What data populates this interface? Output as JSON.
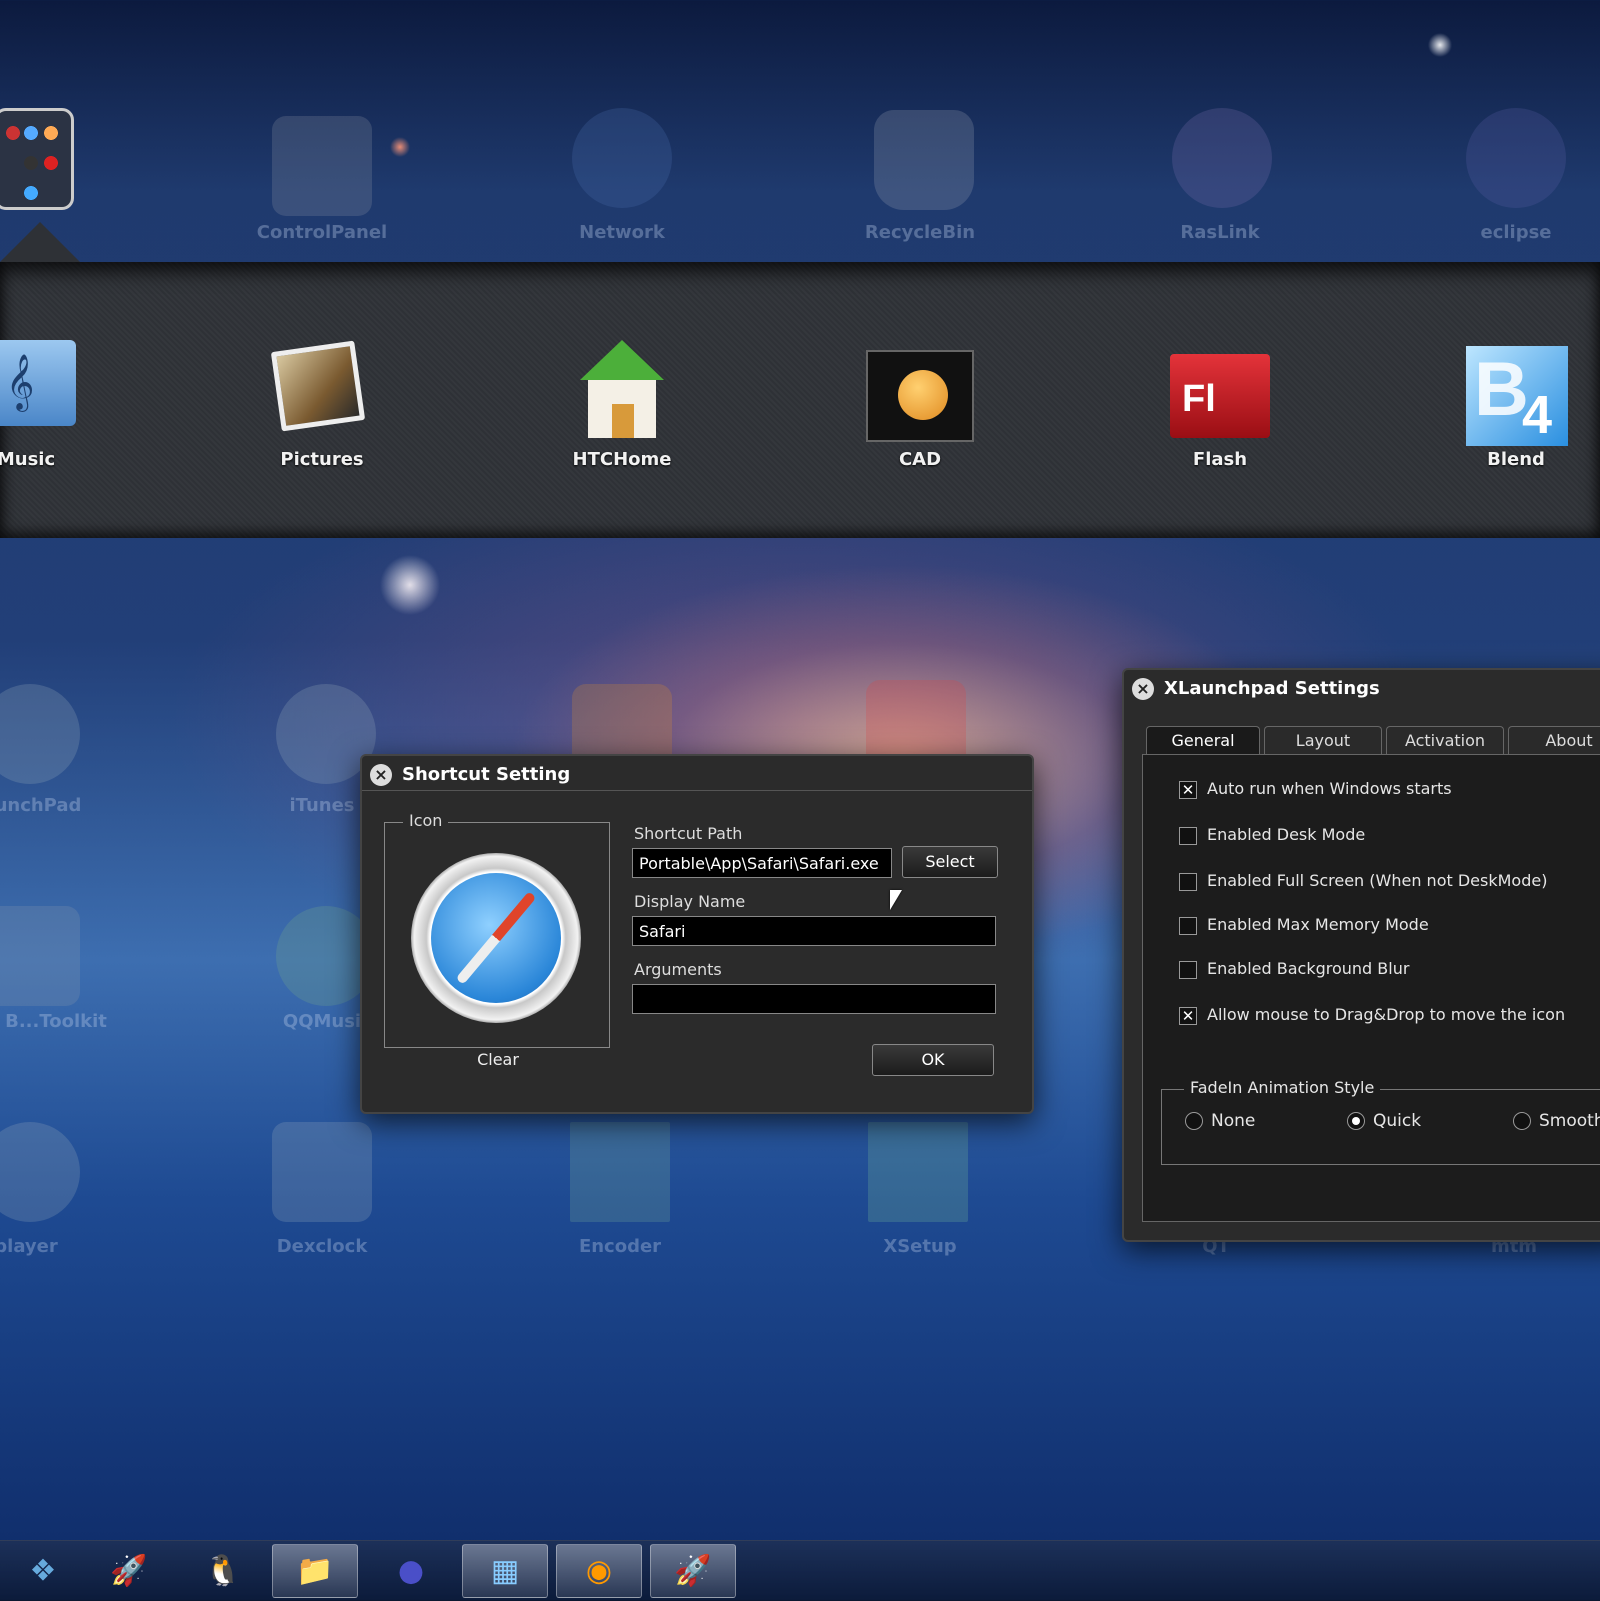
{
  "top_row": [
    {
      "label": "ControlPanel",
      "icon": "gear-icon"
    },
    {
      "label": "Network",
      "icon": "globe-icon"
    },
    {
      "label": "RecycleBin",
      "icon": "trash-icon"
    },
    {
      "label": "RasLink",
      "icon": "link-icon"
    },
    {
      "label": "eclipse",
      "icon": "eclipse-icon"
    }
  ],
  "shelf_row": [
    {
      "label": "Music",
      "icon": "music-folder-icon"
    },
    {
      "label": "Pictures",
      "icon": "pictures-icon"
    },
    {
      "label": "HTCHome",
      "icon": "house-icon"
    },
    {
      "label": "CAD",
      "icon": "cad-icon"
    },
    {
      "label": "Flash",
      "icon": "flash-icon"
    },
    {
      "label": "Blend",
      "icon": "blend-icon"
    }
  ],
  "desktop_row1": [
    "unchPad",
    "iTunes"
  ],
  "desktop_row2": [
    "B...Toolkit",
    "QQMusi"
  ],
  "desktop_row3": [
    "player",
    "Dexclock",
    "Encoder",
    "XSetup",
    "QT",
    "mtm"
  ],
  "shortcut_dialog": {
    "title": "Shortcut Setting",
    "close": "×",
    "icon_group_label": "Icon",
    "clear_label": "Clear",
    "path_label": "Shortcut Path",
    "path_value": "Portable\\App\\Safari\\Safari.exe",
    "select_label": "Select",
    "name_label": "Display Name",
    "name_value": "Safari",
    "args_label": "Arguments",
    "args_value": "",
    "ok_label": "OK"
  },
  "settings_dialog": {
    "title": "XLaunchpad Settings",
    "close": "×",
    "tabs": [
      "General",
      "Layout",
      "Activation",
      "About"
    ],
    "active_tab": "General",
    "options": [
      {
        "label": "Auto run when Windows starts",
        "checked": true
      },
      {
        "label": "Enabled Desk Mode",
        "checked": false
      },
      {
        "label": "Enabled Full Screen (When not DeskMode)",
        "checked": false
      },
      {
        "label": "Enabled Max Memory Mode",
        "checked": false
      },
      {
        "label": "Enabled Background Blur",
        "checked": false
      },
      {
        "label": "Allow mouse to Drag&Drop to move the icon",
        "checked": true
      }
    ],
    "fade_group_label": "FadeIn Animation Style",
    "fade_options": [
      {
        "label": "None",
        "selected": false
      },
      {
        "label": "Quick",
        "selected": true
      },
      {
        "label": "Smooth",
        "selected": false
      }
    ]
  },
  "taskbar": [
    {
      "icon": "windows-start-icon",
      "glyph": "❖",
      "open": false
    },
    {
      "icon": "rocket-icon",
      "glyph": "🚀",
      "open": false
    },
    {
      "icon": "qq-penguin-icon",
      "glyph": "🐧",
      "open": false
    },
    {
      "icon": "explorer-folder-icon",
      "glyph": "📁",
      "open": true
    },
    {
      "icon": "eclipse-icon",
      "glyph": "●",
      "open": false
    },
    {
      "icon": "control-panel-icon",
      "glyph": "▦",
      "open": true
    },
    {
      "icon": "media-player-icon",
      "glyph": "◉",
      "open": true
    },
    {
      "icon": "launchpad-rocket-icon",
      "glyph": "🚀",
      "open": true
    }
  ]
}
